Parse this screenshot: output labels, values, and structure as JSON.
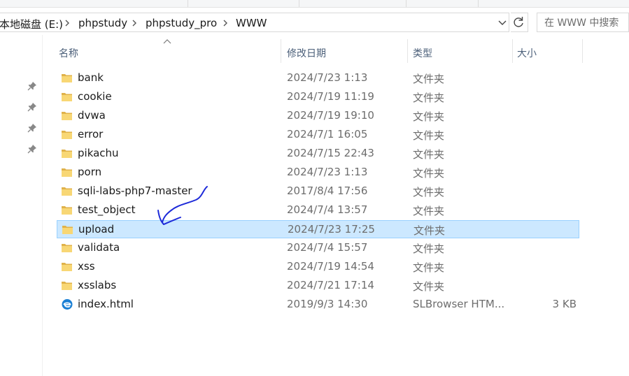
{
  "breadcrumb": {
    "items": [
      "本地磁盘 (E:)",
      "phpstudy",
      "phpstudy_pro",
      "WWW"
    ]
  },
  "search": {
    "placeholder": "在 WWW 中搜索"
  },
  "columns": {
    "name": "名称",
    "date": "修改日期",
    "type": "类型",
    "size": "大小"
  },
  "files": [
    {
      "name": "bank",
      "date": "2024/7/23 1:13",
      "type": "文件夹",
      "size": "",
      "icon": "folder-icon"
    },
    {
      "name": "cookie",
      "date": "2024/7/19 11:19",
      "type": "文件夹",
      "size": "",
      "icon": "folder-icon"
    },
    {
      "name": "dvwa",
      "date": "2024/7/19 19:10",
      "type": "文件夹",
      "size": "",
      "icon": "folder-icon"
    },
    {
      "name": "error",
      "date": "2024/7/1 16:05",
      "type": "文件夹",
      "size": "",
      "icon": "folder-icon"
    },
    {
      "name": "pikachu",
      "date": "2024/7/15 22:43",
      "type": "文件夹",
      "size": "",
      "icon": "folder-icon"
    },
    {
      "name": "porn",
      "date": "2024/7/23 1:13",
      "type": "文件夹",
      "size": "",
      "icon": "folder-icon"
    },
    {
      "name": "sqli-labs-php7-master",
      "date": "2017/8/4 17:56",
      "type": "文件夹",
      "size": "",
      "icon": "folder-icon"
    },
    {
      "name": "test_object",
      "date": "2024/7/4 13:57",
      "type": "文件夹",
      "size": "",
      "icon": "folder-icon"
    },
    {
      "name": "upload",
      "date": "2024/7/23 17:25",
      "type": "文件夹",
      "size": "",
      "icon": "folder-icon",
      "selected": true
    },
    {
      "name": "validata",
      "date": "2024/7/4 15:57",
      "type": "文件夹",
      "size": "",
      "icon": "folder-icon"
    },
    {
      "name": "xss",
      "date": "2024/7/19 14:54",
      "type": "文件夹",
      "size": "",
      "icon": "folder-icon"
    },
    {
      "name": "xsslabs",
      "date": "2024/7/21 17:14",
      "type": "文件夹",
      "size": "",
      "icon": "folder-icon"
    },
    {
      "name": "index.html",
      "date": "2019/9/3 14:30",
      "type": "SLBrowser HTM...",
      "size": "3 KB",
      "icon": "browser-html-icon"
    }
  ],
  "colors": {
    "selection_bg": "#cce8ff",
    "selection_border": "#99d1ff",
    "folder_yellow": "#f8d775",
    "annotation_ink": "#1e2bd9"
  }
}
